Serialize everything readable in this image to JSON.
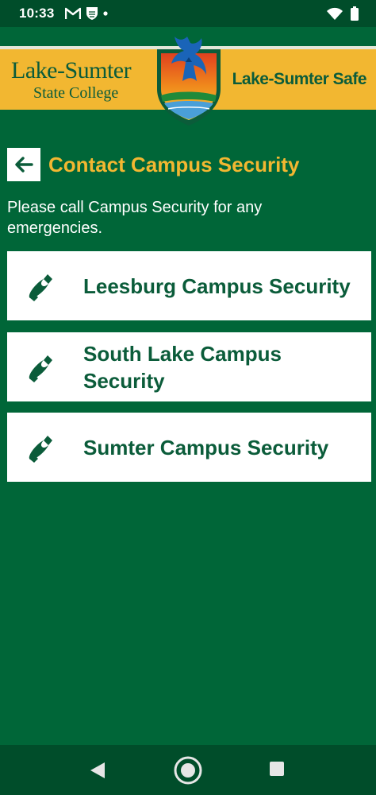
{
  "status_bar": {
    "time": "10:33",
    "icons": [
      "gmail-icon",
      "shield-app-icon",
      "notification-dot-icon",
      "wifi-icon",
      "battery-icon"
    ]
  },
  "header": {
    "college_name_line1": "Lake-Sumter",
    "college_name_line2": "State College",
    "app_name": "Lake-Sumter Safe",
    "logo": "eagle-crest"
  },
  "page": {
    "title": "Contact Campus Security",
    "intro": "Please call Campus Security for any emergencies."
  },
  "contacts": [
    {
      "label": "Leesburg Campus Security",
      "icon": "phone-icon"
    },
    {
      "label": "South Lake Campus Security",
      "icon": "phone-icon"
    },
    {
      "label": "Sumter Campus Security",
      "icon": "phone-icon"
    }
  ],
  "colors": {
    "background": "#006638",
    "accent": "#f2b731",
    "text_green": "#0b5c3a",
    "system_bar": "#004d2a"
  },
  "nav_bar": {
    "buttons": [
      "back",
      "home",
      "recents"
    ]
  }
}
